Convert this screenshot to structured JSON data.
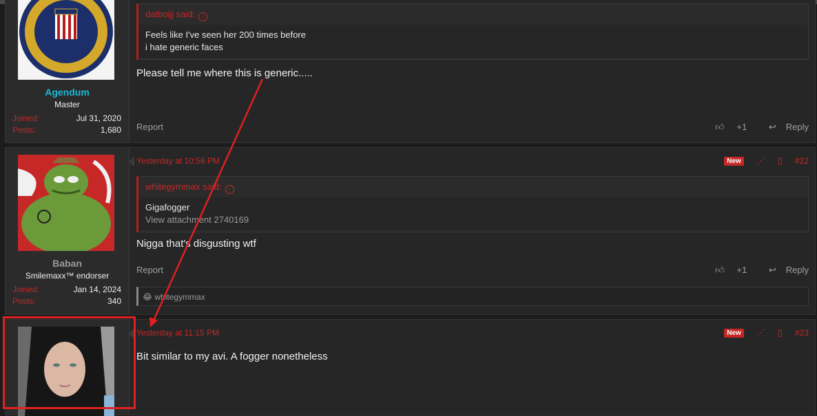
{
  "post1": {
    "quote_author": "datboijj said:",
    "quote_lines": [
      "Feels like I've seen her 200 times before",
      "i hate generic faces"
    ],
    "message": "Please tell me where this is generic.....",
    "user": {
      "name": "Agendum",
      "title": "Master",
      "joined_label": "Joined:",
      "joined": "Jul 31, 2020",
      "posts_label": "Posts:",
      "posts": "1,680",
      "name_color": "#1ab8d8"
    },
    "report": "Report",
    "like": "+1",
    "reply": "Reply"
  },
  "post2": {
    "date": "Yesterday at 10:56 PM",
    "badge": "New",
    "number": "#22",
    "quote_author": "whitegymmax said:",
    "quote_lines": [
      "Gigafogger",
      "View attachment 2740169"
    ],
    "message": "Nigga that's disgusting wtf",
    "user": {
      "name": "Baban",
      "title": "Smilemaxx™ endorser",
      "joined_label": "Joined:",
      "joined": "Jan 14, 2024",
      "posts_label": "Posts:",
      "posts": "340",
      "name_color": "#9a9a9a"
    },
    "report": "Report",
    "like": "+1",
    "reply": "Reply",
    "reaction_user": "whitegymmax"
  },
  "post3": {
    "date": "Yesterday at 11:15 PM",
    "badge": "New",
    "number": "#23",
    "message": "Bit similar to my avi. A fogger nonetheless"
  },
  "icons": [
    "arrow-up-circle-icon",
    "thumbs-up-icon",
    "reply-icon",
    "share-icon",
    "bookmark-icon",
    "laugh-emoji-icon"
  ],
  "colors": {
    "accent": "#c62828",
    "annotation": "#e02020"
  }
}
